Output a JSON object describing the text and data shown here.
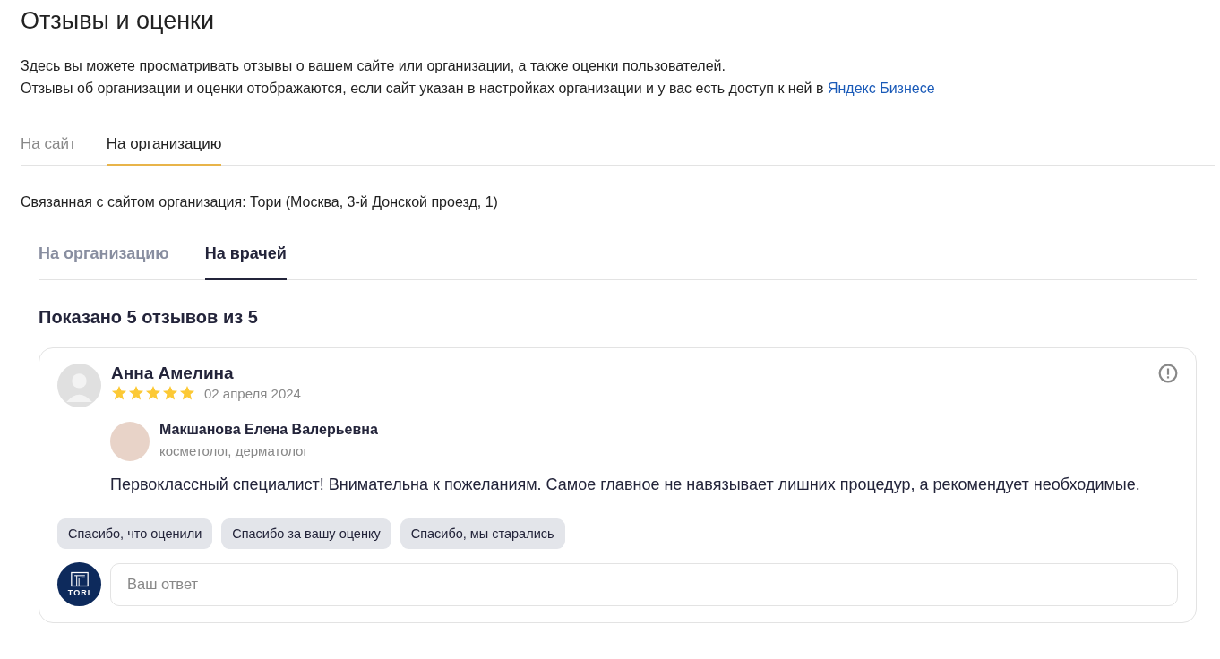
{
  "page": {
    "title": "Отзывы и оценки",
    "description_line_1": "Здесь вы можете просматривать отзывы о вашем сайте или организации, а также оценки пользователей.",
    "description_line_2": "Отзывы об организации и оценки отображаются, если сайт указан в настройках организации и у вас есть доступ к ней в",
    "link": "Яндекс Бизнесе"
  },
  "tabs": [
    {
      "label": "На сайт",
      "selected": false
    },
    {
      "label": "На организацию",
      "selected": true
    }
  ],
  "organization": "Связанная с сайтом организация: Тори (Москва, 3-й Донской проезд, 1)",
  "subtabs": [
    {
      "label": "На организацию",
      "selected": false
    },
    {
      "label": "На врачей",
      "selected": true
    }
  ],
  "summary": "Показано 5 отзывов из 5",
  "reviews": [
    {
      "author": "Анна Амелина",
      "stars": 5,
      "date": "02 апреля 2024",
      "doctor": {
        "name": "Макшанова Елена Валерьевна",
        "specialty": "косметолог, дерматолог"
      },
      "text": "Первоклассный специалист! Внимательна к пожеланиям. Самое главное не навязывает лишних процедур, а рекомендует необходимые.",
      "quick_replies": [
        "Спасибо, что оценили",
        "Спасибо за вашу оценку",
        "Спасибо, мы старались"
      ],
      "reply": {
        "logo_text": "TORI",
        "placeholder": "Ваш ответ"
      }
    }
  ]
}
